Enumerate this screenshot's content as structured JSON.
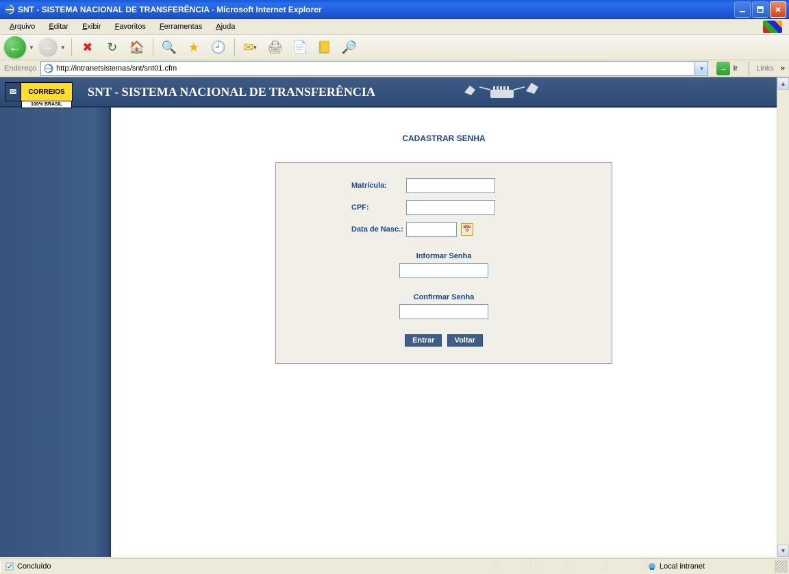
{
  "window": {
    "title": "SNT - SISTEMA NACIONAL DE TRANSFERÊNCIA - Microsoft Internet Explorer"
  },
  "menu": {
    "arquivo": "Arquivo",
    "editar": "Editar",
    "exibir": "Exibir",
    "favoritos": "Favoritos",
    "ferramentas": "Ferramentas",
    "ajuda": "Ajuda"
  },
  "addressbar": {
    "label": "Endereço",
    "url": "http://intranetsistemas/snt/snt01.cfm",
    "go": "Ir",
    "links": "Links"
  },
  "banner": {
    "logo": "CORREIOS",
    "title": "SNT - SISTEMA NACIONAL DE TRANSFERÊNCIA"
  },
  "page": {
    "title": "CADASTRAR SENHA",
    "fields": {
      "matricula": "Matrícula:",
      "cpf": "CPF:",
      "datanasc": "Data de Nasc.:",
      "informar": "Informar Senha",
      "confirmar": "Confirmar Senha"
    },
    "buttons": {
      "entrar": "Entrar",
      "voltar": "Voltar"
    }
  },
  "status": {
    "done": "Concluído",
    "zone": "Local intranet"
  }
}
